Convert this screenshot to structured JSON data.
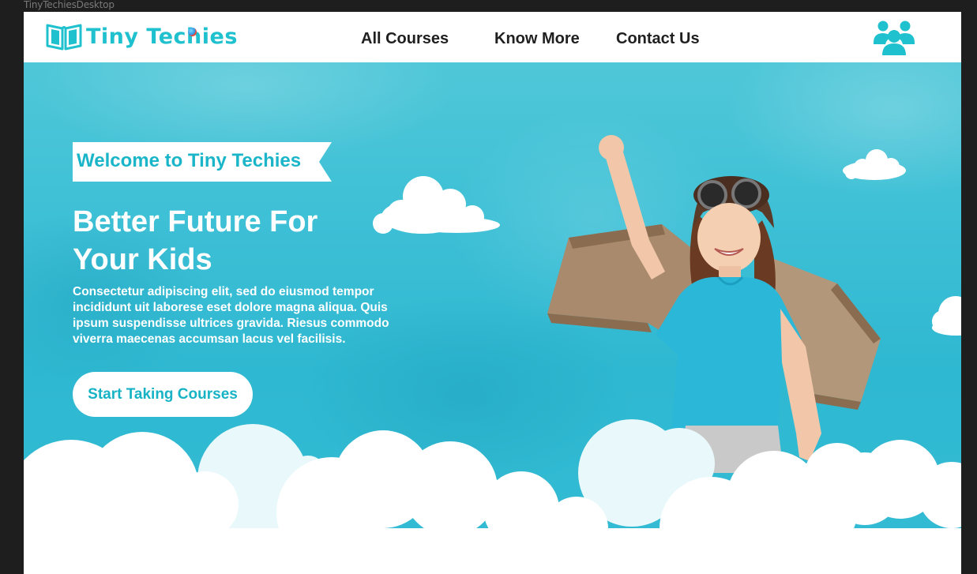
{
  "frame": {
    "label": "TinyTechiesDesktop"
  },
  "brand": {
    "name": "Tiny Techies",
    "logo_icon": "open-book-icon",
    "primary_color": "#1fc1cf",
    "dark_text_color": "#202020"
  },
  "nav": {
    "items": [
      {
        "label": "All Courses"
      },
      {
        "label": "Know More"
      },
      {
        "label": "Contact Us"
      }
    ],
    "account_icon": "users-group-icon"
  },
  "hero": {
    "tag": "Welcome to Tiny Techies",
    "title_line1": "Better Future For",
    "title_line2": "Your Kids",
    "description": "Consectetur adipiscing elit, sed do eiusmod tempor incididunt uit laborese eset dolore magna aliqua. Quis ipsum suspendisse ultrices gravida. Riesus commodo viverra maecenas accumsan lacus vel facilisis.",
    "cta_label": "Start Taking Courses",
    "background_color": "#3ec0d6",
    "illustration": "girl-with-cardboard-wings-image"
  }
}
